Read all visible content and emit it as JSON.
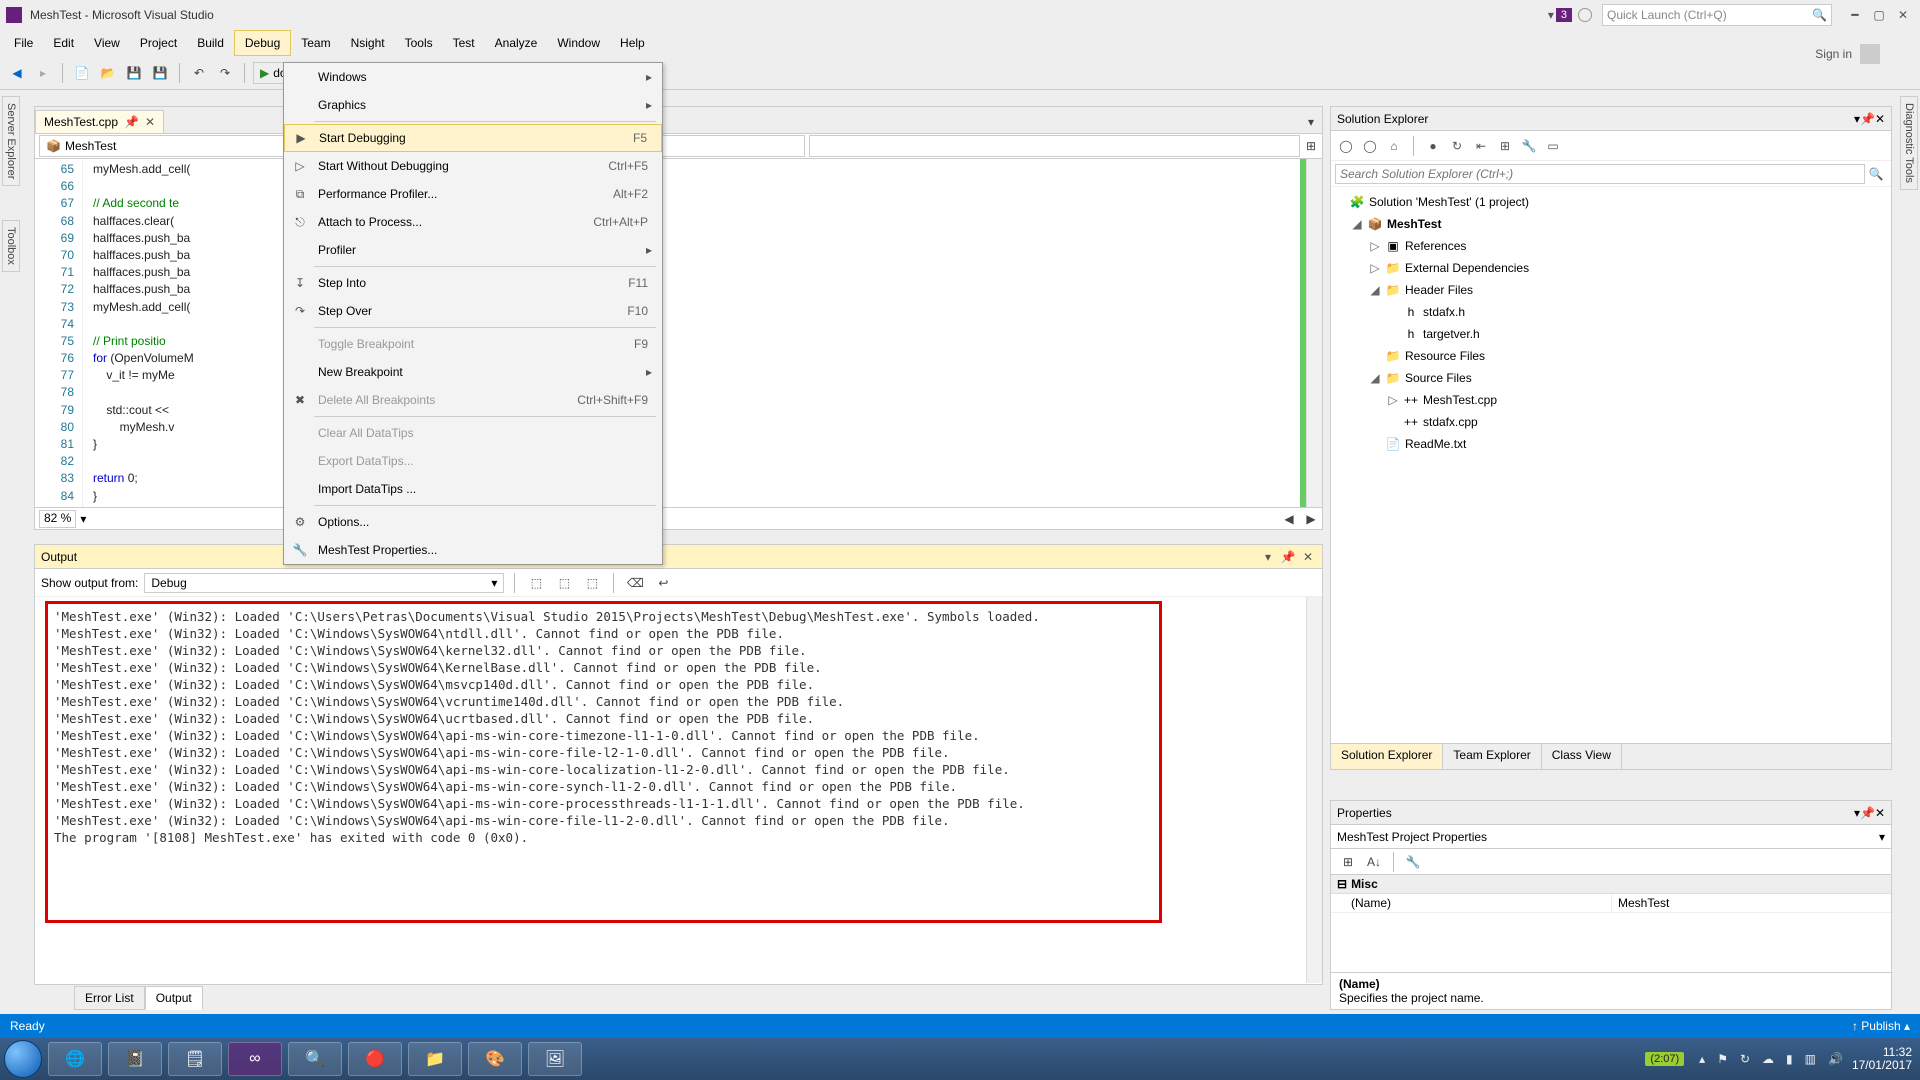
{
  "window": {
    "title": "MeshTest - Microsoft Visual Studio",
    "notif_count": "3",
    "quick_launch_placeholder": "Quick Launch (Ctrl+Q)",
    "sign_in": "Sign in"
  },
  "menu": {
    "items": [
      "File",
      "Edit",
      "View",
      "Project",
      "Build",
      "Debug",
      "Team",
      "Nsight",
      "Tools",
      "Test",
      "Analyze",
      "Window",
      "Help"
    ],
    "active_index": 5
  },
  "side_rails": {
    "left1": "Server Explorer",
    "left2": "Toolbox",
    "right": "Diagnostic Tools"
  },
  "debug_menu": {
    "items": [
      {
        "label": "Windows",
        "submenu": true
      },
      {
        "label": "Graphics",
        "submenu": true
      },
      {
        "sep": true
      },
      {
        "icon": "▶",
        "label": "Start Debugging",
        "shortcut": "F5",
        "hl": true
      },
      {
        "icon": "▷",
        "label": "Start Without Debugging",
        "shortcut": "Ctrl+F5"
      },
      {
        "icon": "⧉",
        "label": "Performance Profiler...",
        "shortcut": "Alt+F2"
      },
      {
        "icon": "⎋",
        "label": "Attach to Process...",
        "shortcut": "Ctrl+Alt+P"
      },
      {
        "label": "Profiler",
        "submenu": true
      },
      {
        "sep": true
      },
      {
        "icon": "↧",
        "label": "Step Into",
        "shortcut": "F11"
      },
      {
        "icon": "↷",
        "label": "Step Over",
        "shortcut": "F10"
      },
      {
        "sep": true
      },
      {
        "label": "Toggle Breakpoint",
        "shortcut": "F9",
        "disabled": true
      },
      {
        "label": "New Breakpoint",
        "submenu": true
      },
      {
        "icon": "✖",
        "label": "Delete All Breakpoints",
        "shortcut": "Ctrl+Shift+F9",
        "disabled": true
      },
      {
        "sep": true
      },
      {
        "label": "Clear All DataTips",
        "disabled": true
      },
      {
        "label": "Export DataTips...",
        "disabled": true
      },
      {
        "label": "Import DataTips ..."
      },
      {
        "sep": true
      },
      {
        "icon": "⚙",
        "label": "Options..."
      },
      {
        "icon": "🔧",
        "label": "MeshTest Properties..."
      }
    ]
  },
  "toolbar": {
    "debugger_label": "dows Debugger"
  },
  "editor": {
    "tab_name": "MeshTest.cpp",
    "crumb": "MeshTest",
    "zoom": "82 %",
    "first_line": 65,
    "lines": [
      "myMesh.add_cell(",
      "",
      "// Add second te",
      "halffaces.clear(",
      "halffaces.push_ba",
      "halffaces.push_ba",
      "halffaces.push_ba",
      "halffaces.push_ba",
      "myMesh.add_cell(",
      "",
      "// Print positio",
      "for (OpenVolumeM",
      "    v_it != myMe",
      "",
      "    std::cout <<",
      "        myMesh.v",
      "}",
      "",
      "return 0;",
      "}"
    ]
  },
  "output": {
    "title": "Output",
    "from_label": "Show output from:",
    "from_value": "Debug",
    "lines": [
      "'MeshTest.exe' (Win32): Loaded 'C:\\Users\\Petras\\Documents\\Visual Studio 2015\\Projects\\MeshTest\\Debug\\MeshTest.exe'. Symbols loaded.",
      "'MeshTest.exe' (Win32): Loaded 'C:\\Windows\\SysWOW64\\ntdll.dll'. Cannot find or open the PDB file.",
      "'MeshTest.exe' (Win32): Loaded 'C:\\Windows\\SysWOW64\\kernel32.dll'. Cannot find or open the PDB file.",
      "'MeshTest.exe' (Win32): Loaded 'C:\\Windows\\SysWOW64\\KernelBase.dll'. Cannot find or open the PDB file.",
      "'MeshTest.exe' (Win32): Loaded 'C:\\Windows\\SysWOW64\\msvcp140d.dll'. Cannot find or open the PDB file.",
      "'MeshTest.exe' (Win32): Loaded 'C:\\Windows\\SysWOW64\\vcruntime140d.dll'. Cannot find or open the PDB file.",
      "'MeshTest.exe' (Win32): Loaded 'C:\\Windows\\SysWOW64\\ucrtbased.dll'. Cannot find or open the PDB file.",
      "'MeshTest.exe' (Win32): Loaded 'C:\\Windows\\SysWOW64\\api-ms-win-core-timezone-l1-1-0.dll'. Cannot find or open the PDB file.",
      "'MeshTest.exe' (Win32): Loaded 'C:\\Windows\\SysWOW64\\api-ms-win-core-file-l2-1-0.dll'. Cannot find or open the PDB file.",
      "'MeshTest.exe' (Win32): Loaded 'C:\\Windows\\SysWOW64\\api-ms-win-core-localization-l1-2-0.dll'. Cannot find or open the PDB file.",
      "'MeshTest.exe' (Win32): Loaded 'C:\\Windows\\SysWOW64\\api-ms-win-core-synch-l1-2-0.dll'. Cannot find or open the PDB file.",
      "'MeshTest.exe' (Win32): Loaded 'C:\\Windows\\SysWOW64\\api-ms-win-core-processthreads-l1-1-1.dll'. Cannot find or open the PDB file.",
      "'MeshTest.exe' (Win32): Loaded 'C:\\Windows\\SysWOW64\\api-ms-win-core-file-l1-2-0.dll'. Cannot find or open the PDB file.",
      "The program '[8108] MeshTest.exe' has exited with code 0 (0x0)."
    ]
  },
  "bottom_tabs": {
    "error_list": "Error List",
    "output": "Output"
  },
  "solution": {
    "title": "Solution Explorer",
    "search_placeholder": "Search Solution Explorer (Ctrl+;)",
    "root": "Solution 'MeshTest' (1 project)",
    "project": "MeshTest",
    "nodes": {
      "references": "References",
      "ext_deps": "External Dependencies",
      "header_files": "Header Files",
      "stdafx_h": "stdafx.h",
      "targetver_h": "targetver.h",
      "resource_files": "Resource Files",
      "source_files": "Source Files",
      "meshtest_cpp": "MeshTest.cpp",
      "stdafx_cpp": "stdafx.cpp",
      "readme": "ReadMe.txt"
    },
    "tabs": [
      "Solution Explorer",
      "Team Explorer",
      "Class View"
    ]
  },
  "properties": {
    "title": "Properties",
    "selector": "MeshTest Project Properties",
    "cat": "Misc",
    "name_key": "(Name)",
    "name_val": "MeshTest",
    "desc_h": "(Name)",
    "desc": "Specifies the project name."
  },
  "status": {
    "ready": "Ready",
    "publish": "Publish"
  },
  "taskbar": {
    "battery": "(2:07)",
    "time": "11:32",
    "date": "17/01/2017"
  }
}
